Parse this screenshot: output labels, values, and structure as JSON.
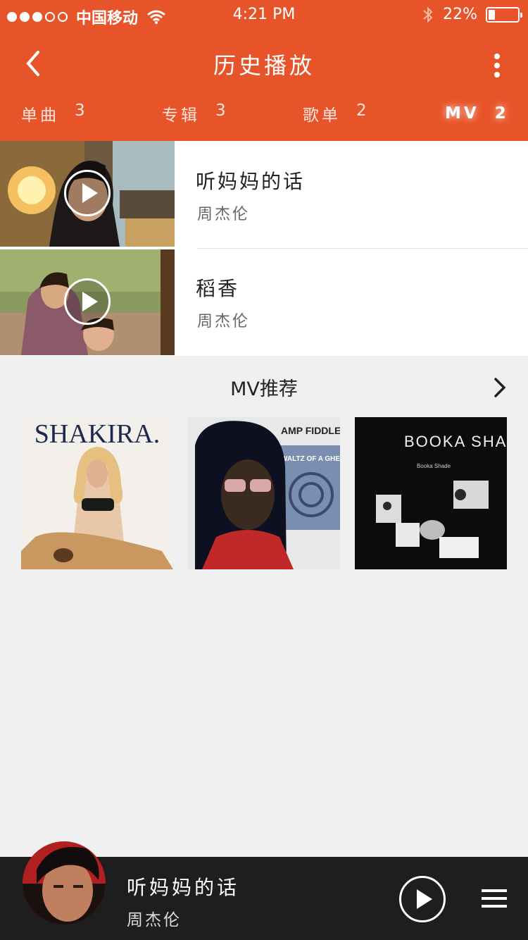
{
  "status_bar": {
    "carrier": "中国移动",
    "time": "4:21 PM",
    "battery": "22%",
    "battery_level": 0.22,
    "signal_dots_filled": 3,
    "signal_dots_total": 5
  },
  "navbar": {
    "title": "历史播放",
    "back_icon": "chevron-left-icon",
    "more_icon": "vertical-dots-icon"
  },
  "tabs": [
    {
      "label": "单曲",
      "count": "3"
    },
    {
      "label": "专辑",
      "count": "3"
    },
    {
      "label": "歌单",
      "count": "2"
    },
    {
      "label": "MV",
      "count": "2",
      "active": true
    }
  ],
  "mv_list": [
    {
      "title": "听妈妈的话",
      "artist": "周杰伦"
    },
    {
      "title": "稻香",
      "artist": "周杰伦"
    }
  ],
  "recommend": {
    "title": "MV推荐",
    "cards": [
      {
        "cover_text": "SHAKIRA."
      },
      {
        "cover_text_1": "AMP FIDDLER",
        "cover_text_2": "WALTZ OF A GHETTO FLY"
      },
      {
        "cover_text_1": "BOOKA SHADE",
        "cover_text_2": "Booka Shade"
      }
    ]
  },
  "player": {
    "title": "听妈妈的话",
    "artist": "周杰伦",
    "play_icon": "play-icon",
    "playlist_icon": "playlist-icon"
  },
  "colors": {
    "accent": "#e8542a",
    "player_bg": "#1e1e1e",
    "page_bg": "#f0f0f0"
  }
}
